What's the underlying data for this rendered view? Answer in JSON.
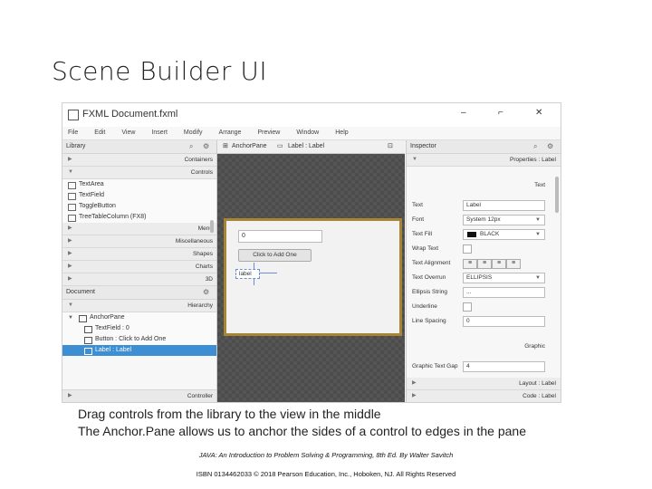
{
  "slide": {
    "title": "Scene Builder UI",
    "caption_1": "Drag controls from the library to the view in the middle",
    "caption_2": "The Anchor.Pane allows us to anchor the sides of a control to edges in the pane",
    "footer_1": "JAVA: An Introduction to Problem Solving & Programming, 8th Ed. By Walter Savitch",
    "footer_2": "ISBN 0134462033 © 2018 Pearson Education, Inc., Hoboken, NJ. All Rights Reserved"
  },
  "window": {
    "title": "FXML Document.fxml",
    "minimize": "–",
    "maximize": "⌐",
    "close": "✕",
    "menus": [
      "File",
      "Edit",
      "View",
      "Insert",
      "Modify",
      "Arrange",
      "Preview",
      "Window",
      "Help"
    ]
  },
  "library": {
    "header": "Library",
    "sections_top": [
      "Containers",
      "Controls"
    ],
    "items": [
      "TextArea",
      "TextField",
      "ToggleButton",
      "TreeTableColumn (FX8)"
    ],
    "sections_bottom": [
      "Menu",
      "Miscellaneous",
      "Shapes",
      "Charts",
      "3D"
    ]
  },
  "document": {
    "header": "Document",
    "hierarchy_label": "Hierarchy",
    "tree": [
      {
        "label": "AnchorPane"
      },
      {
        "label": "TextField : 0"
      },
      {
        "label": "Button : Click to Add One"
      },
      {
        "label": "Label : Label"
      }
    ],
    "controller_label": "Controller"
  },
  "center": {
    "crumb_1": "AnchorPane",
    "crumb_2": "Label : Label",
    "textfield_value": "0",
    "button_label": "Click to Add One",
    "label_value": "label"
  },
  "inspector": {
    "header": "Inspector",
    "properties_label": "Properties : Label",
    "section_text": "Text",
    "props": [
      {
        "name": "Text",
        "value": "Label",
        "kind": "input"
      },
      {
        "name": "Font",
        "value": "System 12px",
        "kind": "select"
      },
      {
        "name": "Text Fill",
        "value": "BLACK",
        "kind": "color"
      },
      {
        "name": "Wrap Text",
        "value": "",
        "kind": "check"
      },
      {
        "name": "Text Alignment",
        "value": "",
        "kind": "align"
      },
      {
        "name": "Text Overrun",
        "value": "ELLIPSIS",
        "kind": "select"
      },
      {
        "name": "Ellipsis String",
        "value": "...",
        "kind": "input"
      },
      {
        "name": "Underline",
        "value": "",
        "kind": "check"
      },
      {
        "name": "Line Spacing",
        "value": "0",
        "kind": "input"
      }
    ],
    "graphic_label": "Graphic",
    "graphic_gap_label": "Graphic Text Gap",
    "graphic_gap_value": "4",
    "layout_label": "Layout : Label",
    "code_label": "Code : Label"
  },
  "colors": {
    "selection": "#3d8ed3",
    "stage_border": "#a88534",
    "canvas": "#555555"
  }
}
